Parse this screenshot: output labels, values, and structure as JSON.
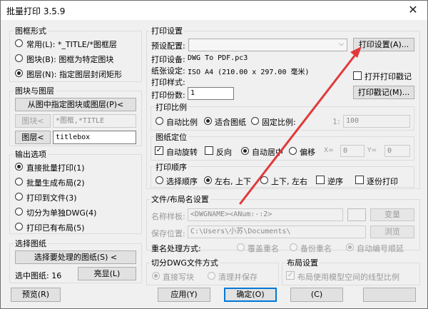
{
  "window": {
    "title": "批量打印 3.5.9",
    "close": "✕"
  },
  "frame_form": {
    "title": "图框形式",
    "options": [
      {
        "label": "常用(L): *_TITLE/*图框层",
        "selected": false
      },
      {
        "label": "图块(B): 图框为特定图块",
        "selected": false
      },
      {
        "label": "图层(N): 指定图层封闭矩形",
        "selected": true
      }
    ]
  },
  "block_layer": {
    "title": "图块与图层",
    "pick_button": "从图中指定图块或图层(P)<",
    "block_button": "图块<",
    "block_value": "*图框,*TITLE",
    "layer_button": "图层<",
    "layer_value": "titlebox"
  },
  "output": {
    "title": "输出选项",
    "options": [
      {
        "label": "直接批量打印(1)",
        "selected": true
      },
      {
        "label": "批量生成布局(2)",
        "selected": false
      },
      {
        "label": "打印到文件(3)",
        "selected": false
      },
      {
        "label": "切分为单独DWG(4)",
        "selected": false
      },
      {
        "label": "打印已有布局(5)",
        "selected": false
      }
    ]
  },
  "select_drawings": {
    "title": "选择图纸",
    "select_button": "选择要处理的图纸(S) <",
    "count_label": "选中图纸: 16",
    "highlight_button": "亮显(L)"
  },
  "print_settings": {
    "title": "打印设置",
    "preset_label": "预设配置:",
    "preset_value": "",
    "print_setup_button": "打印设置(A)...",
    "device_label": "打印设备:",
    "device_value": "DWG To PDF.pc3",
    "paper_label": "纸张设定:",
    "paper_value": "ISO A4 (210.00 x 297.00 毫米)",
    "style_label": "打印样式:",
    "style_value": "",
    "copies_label": "打印份数:",
    "copies_value": "1",
    "open_stamp_label": "打开打印戳记",
    "open_stamp_checked": false,
    "stamp_button": "打印戳记(M)..."
  },
  "scale": {
    "title": "打印比例",
    "options": [
      {
        "label": "自动比例",
        "selected": false
      },
      {
        "label": "适合图纸",
        "selected": true
      },
      {
        "label": "固定比例:",
        "selected": false
      }
    ],
    "ratio_prefix": "1:",
    "ratio_value": "100"
  },
  "position": {
    "title": "图纸定位",
    "rotate_label": "自动旋转",
    "rotate_checked": true,
    "reverse_label": "反向",
    "reverse_checked": false,
    "center_label": "自动居中",
    "center_selected": true,
    "offset_label": "偏移",
    "offset_selected": false,
    "x_label": "X=",
    "x_value": "0",
    "y_label": "Y=",
    "y_value": "0"
  },
  "order": {
    "title": "打印顺序",
    "options": [
      {
        "label": "选择顺序",
        "selected": false
      },
      {
        "label": "左右, 上下",
        "selected": true
      },
      {
        "label": "上下, 左右",
        "selected": false
      }
    ],
    "reverse_label": "逆序",
    "reverse_checked": false,
    "reverse_print_label": "逐份打印",
    "reverse_print_checked": false
  },
  "file_layout": {
    "title": "文件/布局名设置",
    "name_label": "名称样板:",
    "name_value": "<DWGNAME><ANum:-:2>",
    "change_button": "变量",
    "save_label": "保存位置:",
    "save_value": "C:\\Users\\小苏\\Documents\\",
    "browse_button": "浏览",
    "rename_label": "重名处理方式:",
    "rename_options": [
      {
        "label": "覆盖重名",
        "selected": false
      },
      {
        "label": "备份重名",
        "selected": false
      },
      {
        "label": "自动编号顺延",
        "selected": true
      }
    ]
  },
  "split_dwg": {
    "title": "切分DWG文件方式",
    "options": [
      {
        "label": "直接写块",
        "selected": true
      },
      {
        "label": "清理并保存",
        "selected": false
      }
    ]
  },
  "layout_settings": {
    "title": "布局设置",
    "linetype_label": "布局使用模型空间的线型比例",
    "linetype_checked": true
  },
  "footer": {
    "preview_button": "预览(R)",
    "apply_button": "应用(Y)",
    "ok_button": "确定(O)",
    "cancel_button": "(C)",
    "help_button": ""
  },
  "colors": {
    "arrow": "#e03a3a",
    "focus": "#0078d7"
  }
}
